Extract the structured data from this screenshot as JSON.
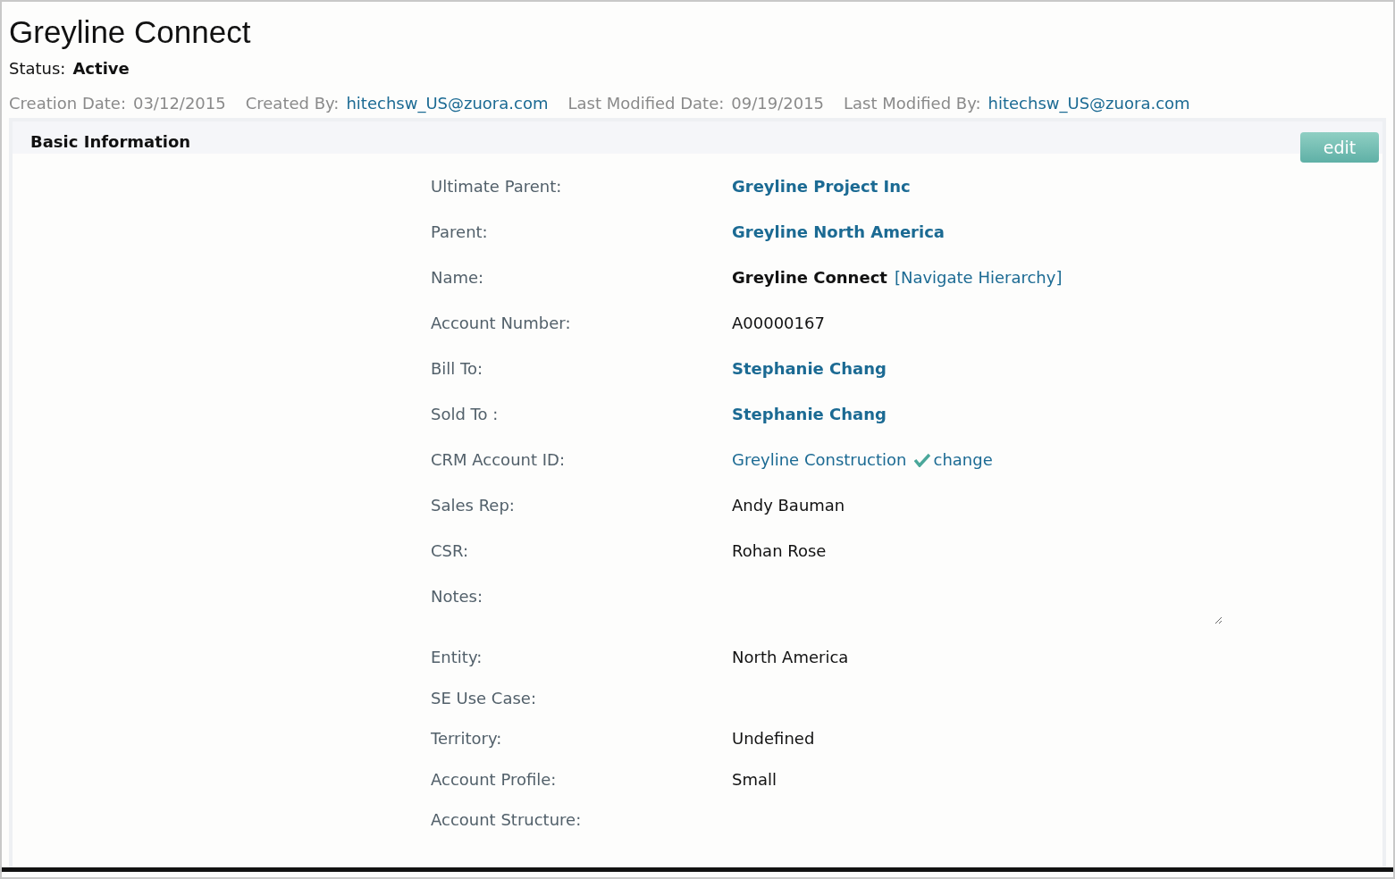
{
  "title": "Greyline Connect",
  "status": {
    "label": "Status:",
    "value": "Active"
  },
  "meta": [
    {
      "label": "Creation Date:",
      "value": "03/12/2015",
      "kind": "text"
    },
    {
      "label": "Created By:",
      "value": "hitechsw_US@zuora.com",
      "kind": "link"
    },
    {
      "label": "Last Modified Date:",
      "value": "09/19/2015",
      "kind": "text"
    },
    {
      "label": "Last Modified By:",
      "value": "hitechsw_US@zuora.com",
      "kind": "link"
    }
  ],
  "section": {
    "title": "Basic Information",
    "edit_button": "edit"
  },
  "fields": [
    {
      "label": "Ultimate Parent:",
      "kind": "link",
      "value": "Greyline Project Inc"
    },
    {
      "label": "Parent:",
      "kind": "link",
      "value": "Greyline North America"
    },
    {
      "label": "Name:",
      "kind": "name",
      "value": "Greyline Connect",
      "link": "[Navigate Hierarchy]"
    },
    {
      "label": "Account Number:",
      "kind": "text",
      "value": "A00000167"
    },
    {
      "label": "Bill To:",
      "kind": "link",
      "value": "Stephanie Chang"
    },
    {
      "label": "Sold To :",
      "kind": "link",
      "value": "Stephanie Chang"
    },
    {
      "label": "CRM Account ID:",
      "kind": "crm",
      "value": "Greyline Construction",
      "link": "change"
    },
    {
      "label": "Sales Rep:",
      "kind": "text",
      "value": "Andy Bauman"
    },
    {
      "label": "CSR:",
      "kind": "text",
      "value": "Rohan Rose"
    },
    {
      "label": "Notes:",
      "kind": "notes"
    },
    {
      "label": "Entity:",
      "kind": "text",
      "value": "North America"
    },
    {
      "label": "SE Use Case:",
      "kind": "empty"
    },
    {
      "label": "Territory:",
      "kind": "text",
      "value": "Undefined"
    },
    {
      "label": "Account Profile:",
      "kind": "text",
      "value": "Small"
    },
    {
      "label": "Account Structure:",
      "kind": "empty"
    }
  ]
}
